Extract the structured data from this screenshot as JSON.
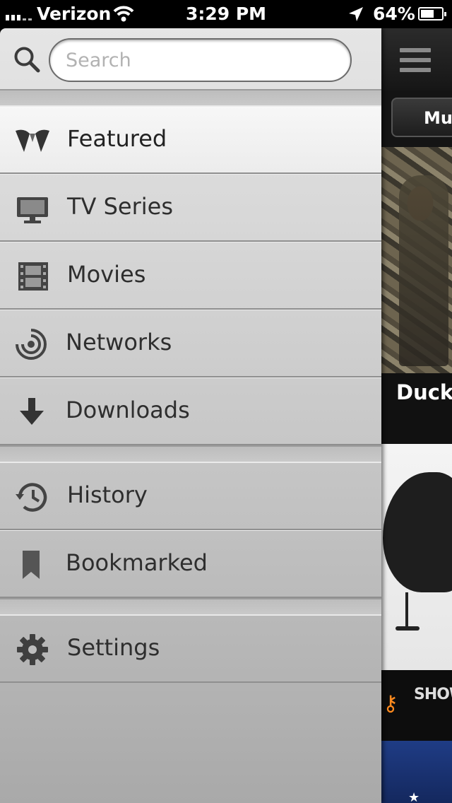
{
  "status_bar": {
    "carrier": "Verizon",
    "time": "3:29 PM",
    "battery": "64%",
    "battery_level": 0.64
  },
  "search": {
    "placeholder": "Search",
    "value": ""
  },
  "menu": {
    "items": [
      {
        "label": "Featured",
        "icon": "featured-icon",
        "active": true
      },
      {
        "label": "TV Series",
        "icon": "tv-icon"
      },
      {
        "label": "Movies",
        "icon": "film-icon"
      },
      {
        "label": "Networks",
        "icon": "broadcast-icon"
      },
      {
        "label": "Downloads",
        "icon": "download-arrow-icon"
      },
      {
        "label": "History",
        "icon": "history-clock-icon"
      },
      {
        "label": "Bookmarked",
        "icon": "bookmark-icon"
      },
      {
        "label": "Settings",
        "icon": "gear-icon"
      }
    ]
  },
  "content": {
    "tab_label": "Music",
    "show_title": "Duck",
    "network_label": "SHOWTI",
    "colors": {
      "key_accent": "#ff8a1e",
      "active_row": "#f4f4f4"
    }
  }
}
